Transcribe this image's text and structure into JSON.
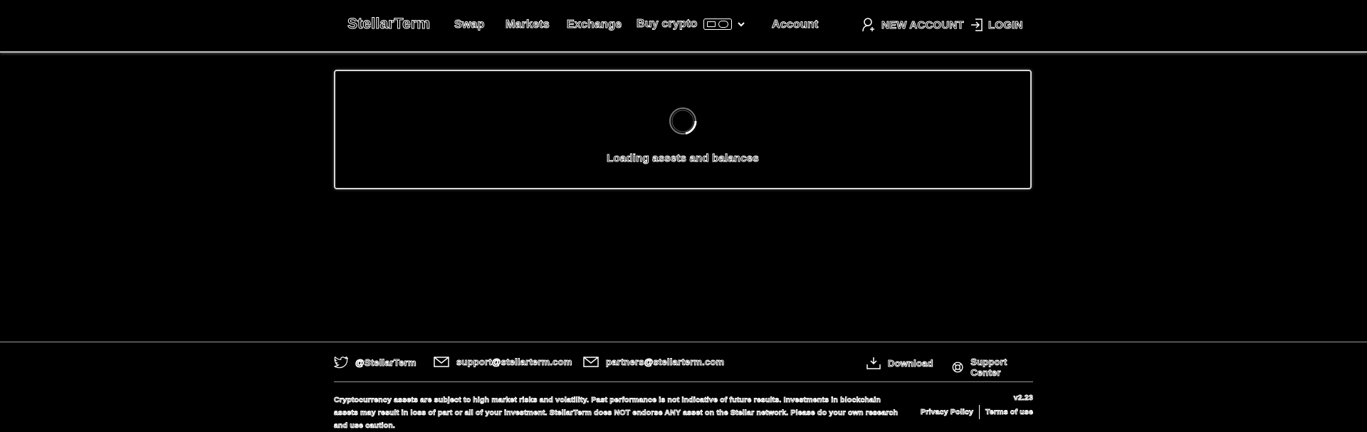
{
  "header": {
    "logo": "StellarTerm",
    "nav": {
      "swap": "Swap",
      "markets": "Markets",
      "exchange": "Exchange",
      "buy_crypto": "Buy crypto",
      "account": "Account"
    },
    "new_account": "NEW ACCOUNT",
    "login": "LOGIN"
  },
  "main": {
    "loading_text": "Loading assets and balances"
  },
  "footer": {
    "twitter": "@StellarTerm",
    "support_email": "support@stellarterm.com",
    "partners_email": "partners@stellarterm.com",
    "download": "Download",
    "support_center": "Support Center",
    "disclaimer": "Cryptocurrency assets are subject to high market risks and volatility. Past performance is not indicative of future results. Investments in blockchain assets may result in loss of part or all of your investment. StellarTerm does NOT endorse ANY asset on the Stellar network. Please do your own research and use caution.",
    "version": "v2.23",
    "privacy_policy": "Privacy Policy",
    "terms_of_use": "Terms of use"
  },
  "icons": {
    "twitter": "twitter-icon",
    "mail": "mail-icon",
    "download": "download-icon",
    "support": "lifebuoy-icon",
    "user": "user-add-icon",
    "login": "login-icon",
    "chevron": "chevron-down-icon",
    "card": "payment-card-icon"
  }
}
